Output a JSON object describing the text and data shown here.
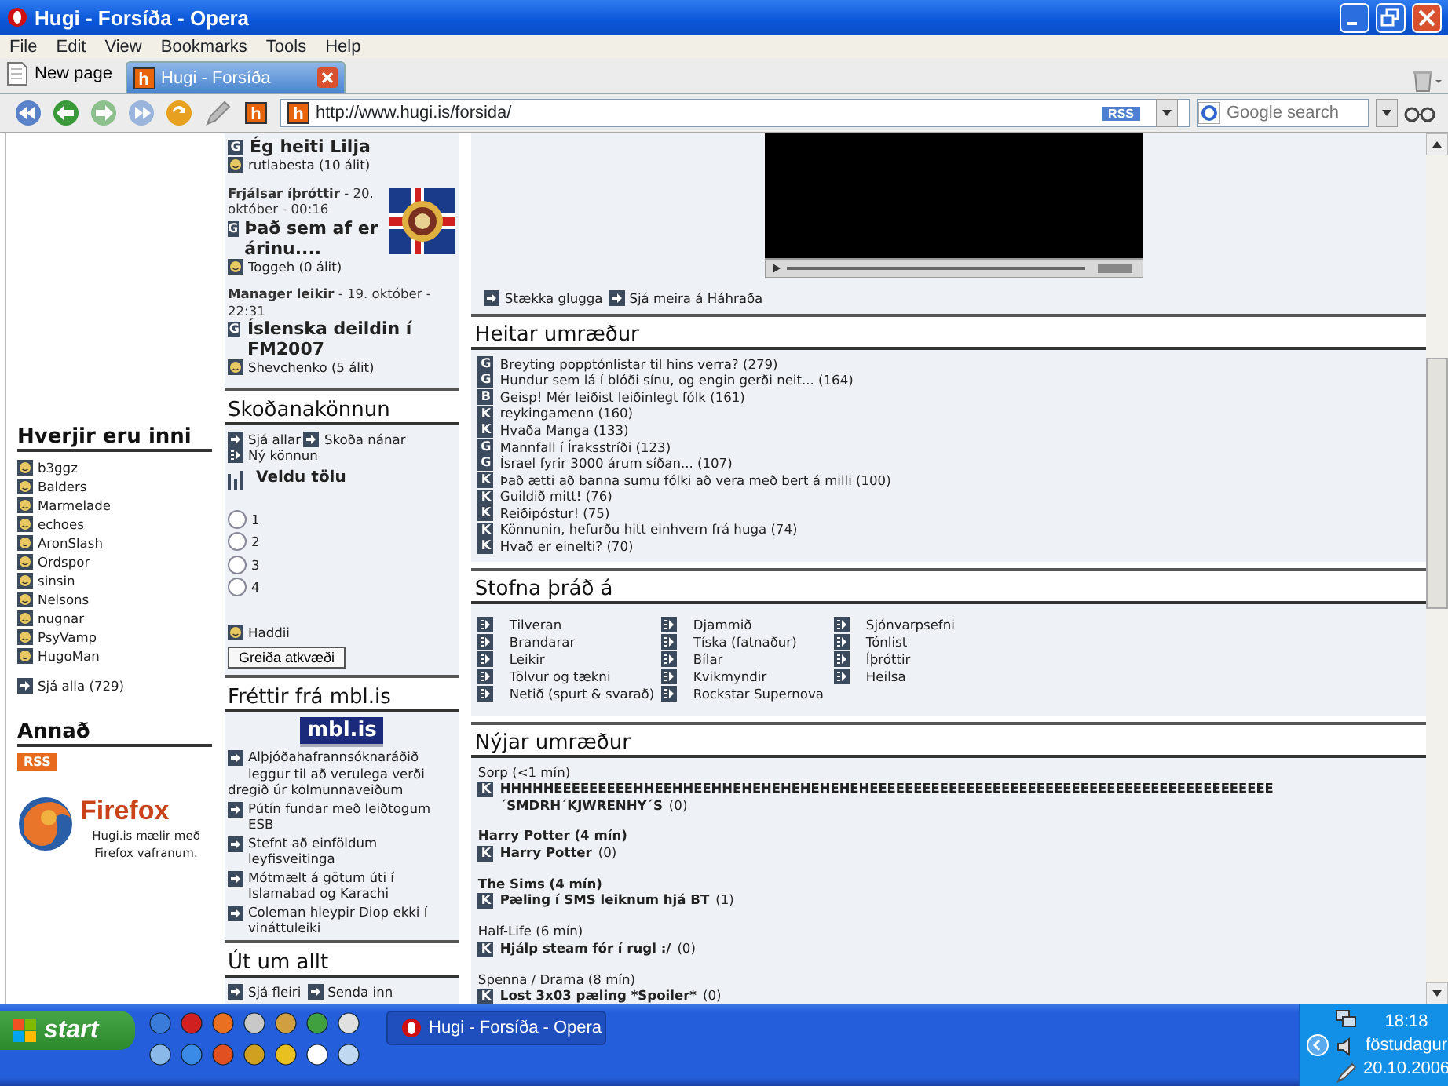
{
  "window": {
    "title": "Hugi - Forsíða - Opera"
  },
  "menu": [
    "File",
    "Edit",
    "View",
    "Bookmarks",
    "Tools",
    "Help"
  ],
  "new_page_button": "New page",
  "tabs": [
    {
      "label": "Hugi - Forsíða",
      "favicon_letter": "h",
      "selected": true
    }
  ],
  "toolbar": {
    "site_letter": "h"
  },
  "address_bar": {
    "favicon_letter": "h",
    "url": "http://www.hugi.is/forsida/",
    "rss": "RSS"
  },
  "search": {
    "placeholder": "Google search"
  },
  "left": {
    "online": {
      "title": "Hverjir eru inni",
      "users": [
        "b3ggz",
        "Balders",
        "Marmelade",
        "echoes",
        "AronSlash",
        "Ordspor",
        "sinsin",
        "Nelsons",
        "nugnar",
        "PsyVamp",
        "HugoMan"
      ],
      "more": "Sjá alla (729)"
    },
    "other": {
      "title": "Annað",
      "rss": "RSS",
      "firefox_name": "Firefox",
      "firefox_text": "Hugi.is mælir með Firefox vafranum."
    }
  },
  "middle": {
    "articles": [
      {
        "kind": "plain",
        "badge": "G",
        "title": "Ég heiti Lilja",
        "author": "rutlabesta (10 álit)"
      },
      {
        "kind": "picture",
        "meta": "**Frjálsar íþróttir** - 20. október - 00:16",
        "badge": "G",
        "title": "Það sem af er árinu....",
        "author": "Toggeh (0 álit)"
      },
      {
        "kind": "plain",
        "meta": "**Manager leikir** - 19. október - 22:31",
        "badge": "G",
        "title": "Íslenska deildin í FM2007",
        "author": "Shevchenko (5 álit)"
      }
    ],
    "poll": {
      "title": "Skoðanakönnun",
      "links": [
        {
          "kind": "arrow",
          "label": "Sjá allar"
        },
        {
          "kind": "arrow",
          "label": "Skoða nánar"
        },
        {
          "kind": "new",
          "label": "Ný könnun"
        }
      ],
      "question": "Veldu tölu",
      "options": [
        {
          "label": "1",
          "selected": false
        },
        {
          "label": "2",
          "selected": false
        },
        {
          "label": "3",
          "selected": false
        },
        {
          "label": "4",
          "selected": false
        }
      ],
      "author": "Haddii",
      "button": "Greiða atkvæði"
    },
    "news": {
      "title": "Fréttir frá mbl.is",
      "logo": "mbl.is",
      "items": [
        "Alþjóðahafrannsóknaráðið leggur til að verulega verði dregið úr kolmunnaveiðum",
        "Pútín fundar með leiðtogum ESB",
        "Stefnt að einföldum leyfisveitinga",
        "Mótmælt á götum úti í Islamabad og Karachi",
        "Coleman hleypir Diop ekki í vináttuleiki"
      ]
    },
    "misc": {
      "title": "Út um allt",
      "links": [
        "Sjá fleiri",
        "Senda inn"
      ]
    }
  },
  "right": {
    "video": {
      "kind": "video"
    },
    "video_links": [
      "Stækka glugga",
      "Sjá meira á Háhraða"
    ],
    "hot": {
      "title": "Heitar umræður",
      "items": [
        {
          "badge": "G",
          "text": "Breyting popptónlistar til hins verra? (279)"
        },
        {
          "badge": "G",
          "text": "Hundur sem lá í blóði sínu, og engin gerði neit... (164)"
        },
        {
          "badge": "B",
          "text": "Geisp! Mér leiðist leiðinlegt fólk (161)"
        },
        {
          "badge": "K",
          "text": "reykingamenn (160)"
        },
        {
          "badge": "K",
          "text": "Hvaða Manga (133)"
        },
        {
          "badge": "G",
          "text": "Mannfall í Íraksstríði (123)"
        },
        {
          "badge": "G",
          "text": "Ísrael fyrir 3000 árum síðan... (107)"
        },
        {
          "badge": "K",
          "text": "Það ætti að banna sumu fólki að vera með bert á milli (100)"
        },
        {
          "badge": "K",
          "text": "Guildið mitt! (76)"
        },
        {
          "badge": "K",
          "text": "Reiðipóstur! (75)"
        },
        {
          "badge": "K",
          "text": "Könnunin, hefurðu hitt einhvern frá huga (74)"
        },
        {
          "badge": "K",
          "text": "Hvað er einelti? (70)"
        }
      ]
    },
    "start_thread": {
      "title": "Stofna þráð á",
      "columns": [
        [
          "Tilveran",
          "Brandarar",
          "Leikir",
          "Tölvur og tækni",
          "Netið (spurt & svarað)"
        ],
        [
          "Djammið",
          "Tíska (fatnaður)",
          "Bílar",
          "Kvikmyndir",
          "Rockstar Supernova"
        ],
        [
          "Sjónvarpsefni",
          "Tónlist",
          "Íþróttir",
          "Heilsa"
        ]
      ]
    },
    "new_threads": {
      "title": "Nýjar umræður",
      "groups": [
        {
          "category": "Sorp (<1 mín)",
          "category_bold": false,
          "badge": "K",
          "title": "HHHHHEEEEEEEEEHHEEHHEEHHEHEHEHEHEHEHEHEEEEEEEEEEEEEEEEEEEEEEEEEEEEEEEEEEEEEEEEEEEEEE",
          "title_rest": "´SMDRH´KJWRENHY´S",
          "count": "(0)"
        },
        {
          "category": "Harry Potter (4 mín)",
          "category_bold": true,
          "badge": "K",
          "title": "Harry Potter",
          "count": "(0)"
        },
        {
          "category": "The Sims (4 mín)",
          "category_bold": true,
          "badge": "K",
          "title": "Pæling í SMS leiknum hjá BT",
          "count": "(1)"
        },
        {
          "category": "Half-Life (6 mín)",
          "category_bold": false,
          "badge": "K",
          "title": "Hjálp steam fór í rugl :/",
          "count": "(0)"
        },
        {
          "category": "Spenna / Drama (8 mín)",
          "category_bold": false,
          "badge": "K",
          "title": "Lost 3x03 pæling *Spoiler*",
          "count": "(0)"
        }
      ]
    }
  },
  "taskbar": {
    "start": "start",
    "tasks": [
      {
        "label": "Hugi - Forsíða - Opera",
        "selected": true
      }
    ],
    "clock": {
      "time": "18:18",
      "day": "föstudagur",
      "date": "20.10.2006"
    }
  }
}
